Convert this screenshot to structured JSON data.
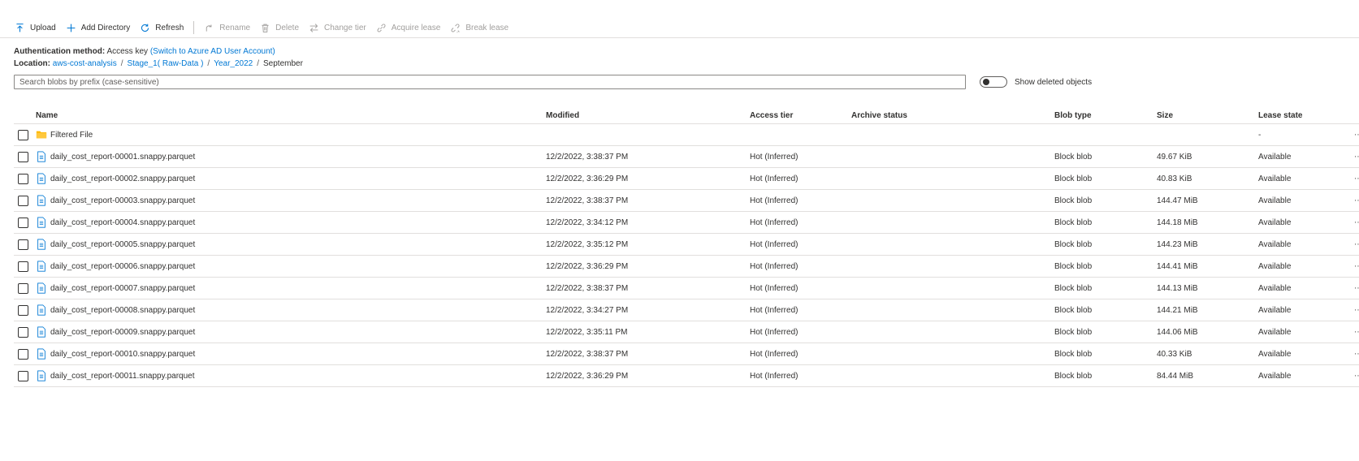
{
  "toolbar": {
    "upload": "Upload",
    "add_directory": "Add Directory",
    "refresh": "Refresh",
    "rename": "Rename",
    "delete": "Delete",
    "change_tier": "Change tier",
    "acquire_lease": "Acquire lease",
    "break_lease": "Break lease"
  },
  "auth": {
    "label": "Authentication method:",
    "value": "Access key",
    "switch_link": "(Switch to Azure AD User Account)"
  },
  "location": {
    "label": "Location:",
    "crumbs": [
      "aws-cost-analysis",
      "Stage_1( Raw-Data )",
      "Year_2022",
      "September"
    ],
    "separator": "/"
  },
  "search": {
    "placeholder": "Search blobs by prefix (case-sensitive)"
  },
  "show_deleted": {
    "label": "Show deleted objects",
    "on": false
  },
  "columns": {
    "name": "Name",
    "modified": "Modified",
    "access_tier": "Access tier",
    "archive_status": "Archive status",
    "blob_type": "Blob type",
    "size": "Size",
    "lease_state": "Lease state"
  },
  "folder": {
    "name": "Filtered File",
    "lease_state": "-",
    "icon": "folder-icon"
  },
  "rows": [
    {
      "name": "daily_cost_report-00001.snappy.parquet",
      "modified": "12/2/2022, 3:38:37 PM",
      "access_tier": "Hot (Inferred)",
      "archive_status": "",
      "blob_type": "Block blob",
      "size": "49.67 KiB",
      "lease_state": "Available"
    },
    {
      "name": "daily_cost_report-00002.snappy.parquet",
      "modified": "12/2/2022, 3:36:29 PM",
      "access_tier": "Hot (Inferred)",
      "archive_status": "",
      "blob_type": "Block blob",
      "size": "40.83 KiB",
      "lease_state": "Available"
    },
    {
      "name": "daily_cost_report-00003.snappy.parquet",
      "modified": "12/2/2022, 3:38:37 PM",
      "access_tier": "Hot (Inferred)",
      "archive_status": "",
      "blob_type": "Block blob",
      "size": "144.47 MiB",
      "lease_state": "Available"
    },
    {
      "name": "daily_cost_report-00004.snappy.parquet",
      "modified": "12/2/2022, 3:34:12 PM",
      "access_tier": "Hot (Inferred)",
      "archive_status": "",
      "blob_type": "Block blob",
      "size": "144.18 MiB",
      "lease_state": "Available"
    },
    {
      "name": "daily_cost_report-00005.snappy.parquet",
      "modified": "12/2/2022, 3:35:12 PM",
      "access_tier": "Hot (Inferred)",
      "archive_status": "",
      "blob_type": "Block blob",
      "size": "144.23 MiB",
      "lease_state": "Available"
    },
    {
      "name": "daily_cost_report-00006.snappy.parquet",
      "modified": "12/2/2022, 3:36:29 PM",
      "access_tier": "Hot (Inferred)",
      "archive_status": "",
      "blob_type": "Block blob",
      "size": "144.41 MiB",
      "lease_state": "Available"
    },
    {
      "name": "daily_cost_report-00007.snappy.parquet",
      "modified": "12/2/2022, 3:38:37 PM",
      "access_tier": "Hot (Inferred)",
      "archive_status": "",
      "blob_type": "Block blob",
      "size": "144.13 MiB",
      "lease_state": "Available"
    },
    {
      "name": "daily_cost_report-00008.snappy.parquet",
      "modified": "12/2/2022, 3:34:27 PM",
      "access_tier": "Hot (Inferred)",
      "archive_status": "",
      "blob_type": "Block blob",
      "size": "144.21 MiB",
      "lease_state": "Available"
    },
    {
      "name": "daily_cost_report-00009.snappy.parquet",
      "modified": "12/2/2022, 3:35:11 PM",
      "access_tier": "Hot (Inferred)",
      "archive_status": "",
      "blob_type": "Block blob",
      "size": "144.06 MiB",
      "lease_state": "Available"
    },
    {
      "name": "daily_cost_report-00010.snappy.parquet",
      "modified": "12/2/2022, 3:38:37 PM",
      "access_tier": "Hot (Inferred)",
      "archive_status": "",
      "blob_type": "Block blob",
      "size": "40.33 KiB",
      "lease_state": "Available"
    },
    {
      "name": "daily_cost_report-00011.snappy.parquet",
      "modified": "12/2/2022, 3:36:29 PM",
      "access_tier": "Hot (Inferred)",
      "archive_status": "",
      "blob_type": "Block blob",
      "size": "84.44 MiB",
      "lease_state": "Available"
    }
  ],
  "colors": {
    "accent": "#0078d4",
    "folder": "#ffb900",
    "disabled": "#a19f9d",
    "border": "#e1dfdd"
  }
}
